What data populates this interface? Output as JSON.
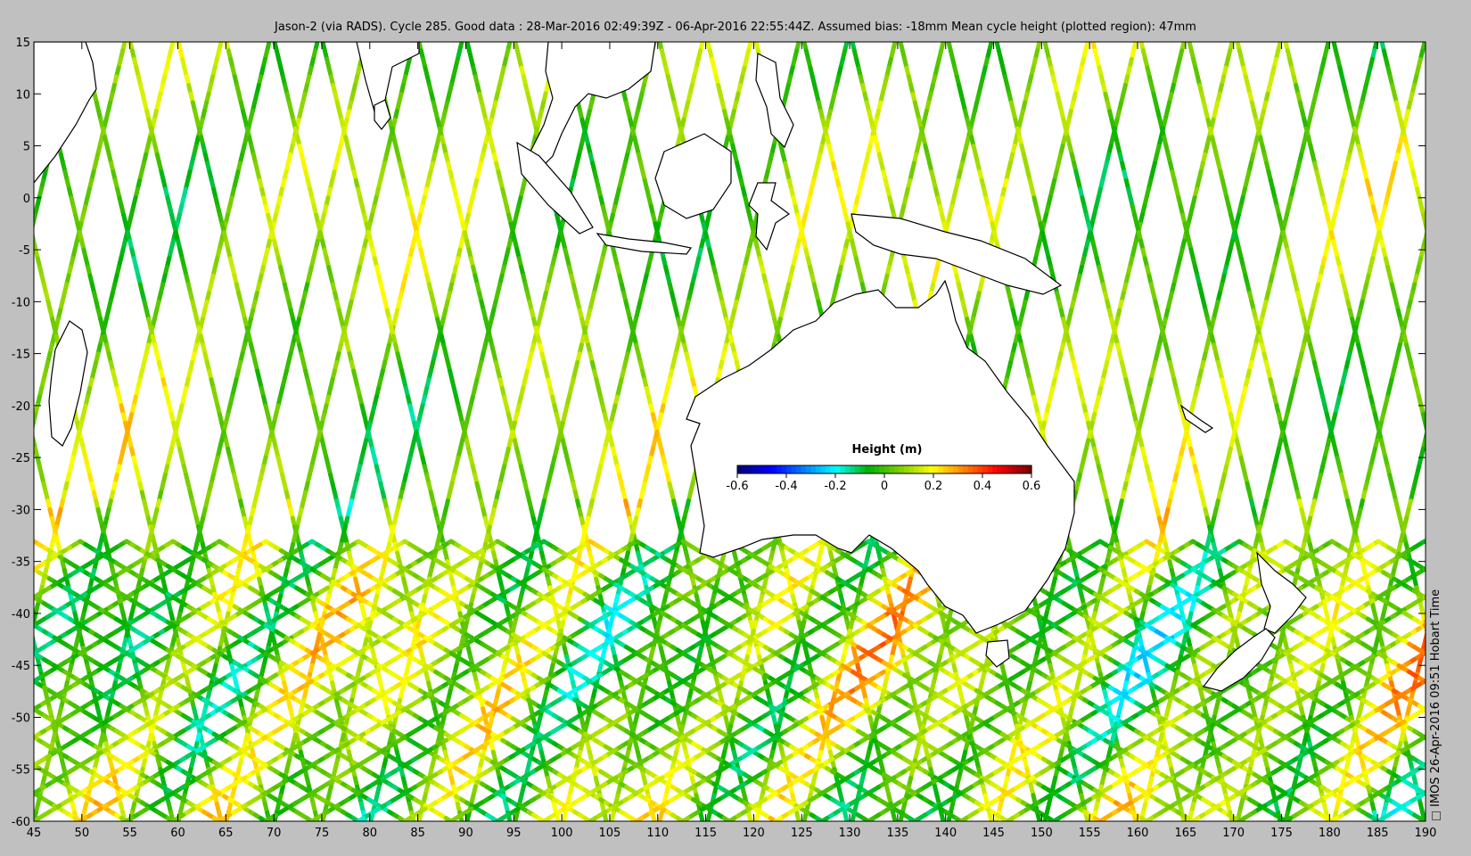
{
  "title": "Jason-2 (via RADS). Cycle 285. Good data : 28-Mar-2016 02:49:39Z - 06-Apr-2016 22:55:44Z. Assumed bias: -18mm  Mean cycle height (plotted region): 47mm",
  "side_label": "IMOS 26-Apr-2016 09:51 Hobart Time",
  "colorbar": {
    "title": "Height (m)",
    "ticks": [
      "-0.6",
      "-0.4",
      "-0.2",
      "0",
      "0.2",
      "0.4",
      "0.6"
    ],
    "range": [
      -0.6,
      0.6
    ],
    "colors": [
      "#00007f",
      "#0000ff",
      "#007fff",
      "#00ffff",
      "#00b000",
      "#7fd000",
      "#ffff00",
      "#ff7f00",
      "#ff0000",
      "#7f0000"
    ]
  },
  "axes": {
    "lon_range": [
      45,
      190
    ],
    "lat_range": [
      -60,
      15
    ],
    "x_ticks": [
      "45",
      "50",
      "55",
      "60",
      "65",
      "70",
      "75",
      "80",
      "85",
      "90",
      "95",
      "100",
      "105",
      "110",
      "115",
      "120",
      "125",
      "130",
      "135",
      "140",
      "145",
      "150",
      "155",
      "160",
      "165",
      "170",
      "175",
      "180",
      "185",
      "190"
    ],
    "y_ticks": [
      "15",
      "10",
      "5",
      "0",
      "-5",
      "-10",
      "-15",
      "-20",
      "-25",
      "-30",
      "-35",
      "-40",
      "-45",
      "-50",
      "-55",
      "-60"
    ]
  },
  "colors": {
    "background": "#c0c0c0",
    "plot": "#ffffff",
    "coast": "#000000"
  }
}
